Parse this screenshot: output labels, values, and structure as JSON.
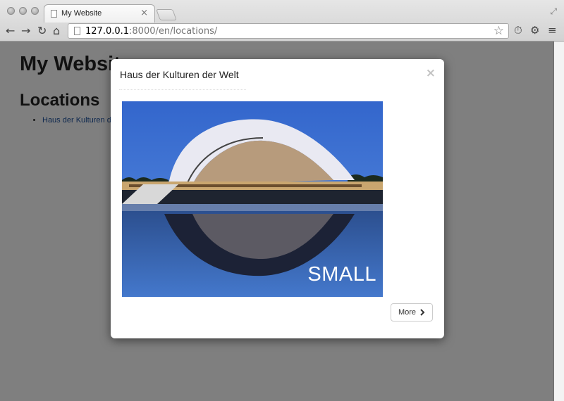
{
  "browser": {
    "tab_title": "My Website",
    "tab_close": "×",
    "url_host": "127.0.0.1",
    "url_rest": ":8000/en/locations/",
    "icons": [
      "back-icon",
      "forward-icon",
      "reload-icon",
      "home-icon",
      "star-icon",
      "timer-icon",
      "gear-icon",
      "menu-icon"
    ]
  },
  "page": {
    "title": "My Website",
    "section_title": "Locations",
    "locations": [
      "Haus der Kulturen der Welt"
    ]
  },
  "modal": {
    "title": "Haus der Kulturen der Welt",
    "close_glyph": "×",
    "photo_label": "SMALL",
    "more_label": "More",
    "more_icon": "chevron-right-icon"
  },
  "colors": {
    "backdrop": "rgba(0,0,0,0.5)",
    "link": "#1a4f9c",
    "sky": "#3b74c4"
  }
}
